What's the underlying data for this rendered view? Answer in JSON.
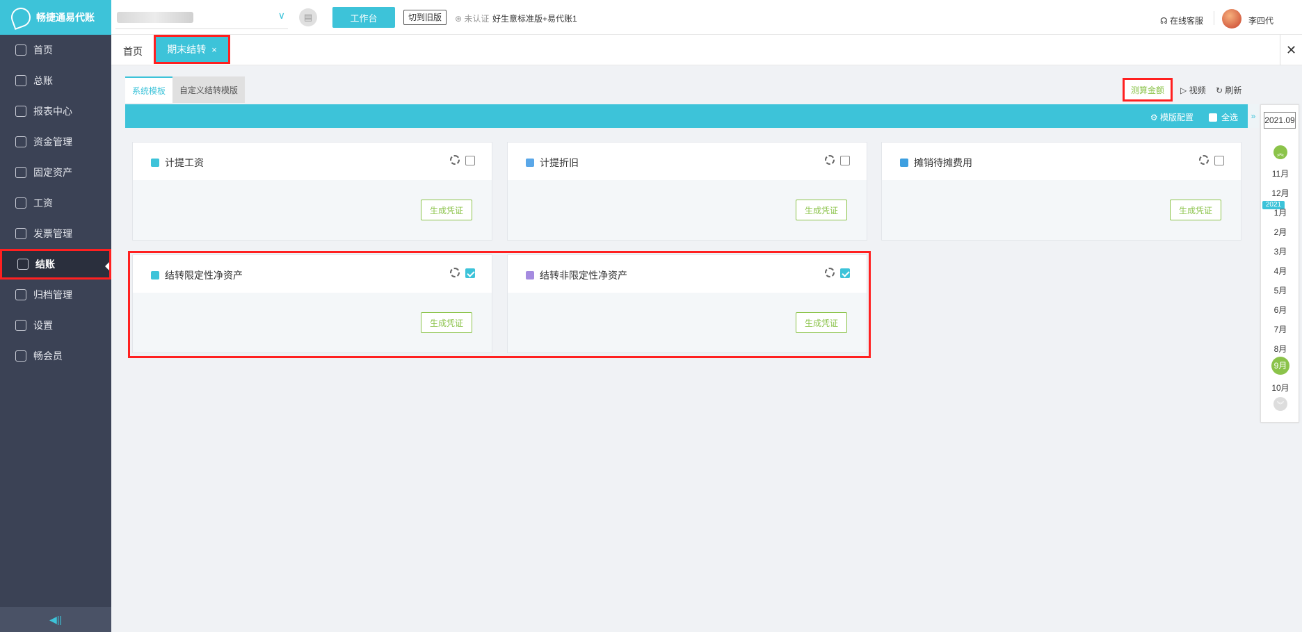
{
  "app": {
    "name": "畅捷通易代账"
  },
  "sidebar": {
    "items": [
      {
        "label": "首页"
      },
      {
        "label": "总账"
      },
      {
        "label": "报表中心"
      },
      {
        "label": "资金管理"
      },
      {
        "label": "固定资产"
      },
      {
        "label": "工资"
      },
      {
        "label": "发票管理"
      },
      {
        "label": "结账",
        "active": true
      },
      {
        "label": "归档管理"
      },
      {
        "label": "设置"
      },
      {
        "label": "畅会员"
      }
    ]
  },
  "header": {
    "workbench_label": "工作台",
    "switch_old_label": "切到旧版",
    "unverified_label": "未认证",
    "product_label": "好生意标准版+易代账1",
    "service_label": "在线客服",
    "user_name": "李四代"
  },
  "tabs": {
    "home_label": "首页",
    "active_label": "期末结转",
    "close_symbol": "×"
  },
  "template_tabs": [
    {
      "label": "系统模板",
      "active": true
    },
    {
      "label": "自定义结转模版",
      "active": false
    }
  ],
  "actions": {
    "measure_label": "测算金额",
    "video_label": "视频",
    "refresh_label": "刷新",
    "template_config_label": "模版配置",
    "select_all_label": "全选"
  },
  "cards": [
    {
      "title": "计提工资",
      "checked": false,
      "button": "生成凭证",
      "icon_color": "#3dc3d9"
    },
    {
      "title": "计提折旧",
      "checked": false,
      "button": "生成凭证",
      "icon_color": "#5aa7e8"
    },
    {
      "title": "摊销待摊费用",
      "checked": false,
      "button": "生成凭证",
      "icon_color": "#3d9fe0"
    },
    {
      "title": "结转限定性净资产",
      "checked": true,
      "button": "生成凭证",
      "icon_color": "#3dc3d9"
    },
    {
      "title": "结转非限定性净资产",
      "checked": true,
      "button": "生成凭证",
      "icon_color": "#a58be0"
    }
  ],
  "period": {
    "year_input": "2021.09",
    "year_badge": "2021",
    "months": [
      "11月",
      "12月",
      "1月",
      "2月",
      "3月",
      "4月",
      "5月",
      "6月",
      "7月",
      "8月",
      "9月",
      "10月"
    ],
    "current": "9月"
  },
  "colors": {
    "accent": "#3dc3d9",
    "sidebar": "#3b4255",
    "green": "#8bc34a",
    "highlight": "#ff2020"
  }
}
